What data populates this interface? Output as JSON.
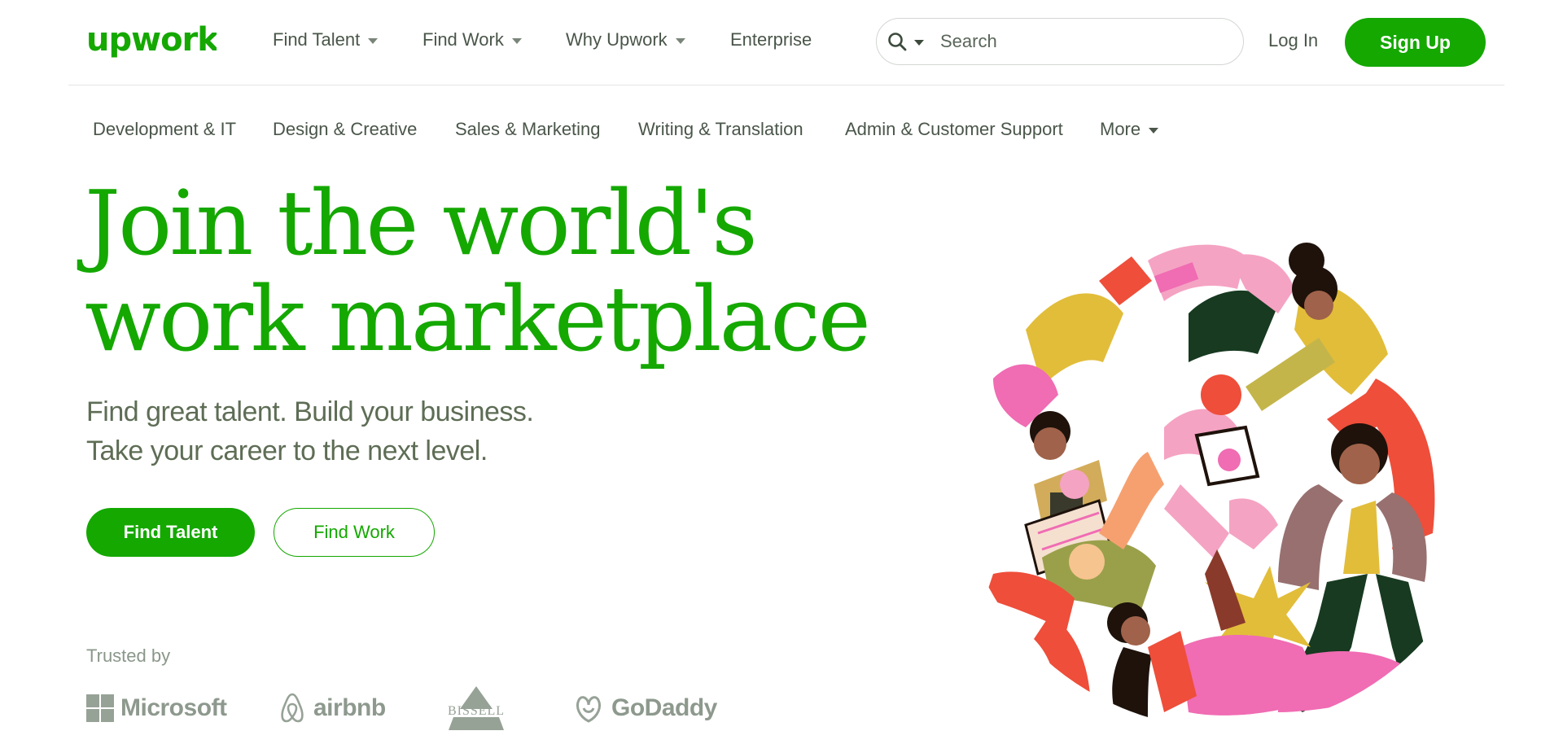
{
  "header": {
    "logo_text": "upwork",
    "nav": [
      {
        "label": "Find Talent",
        "has_menu": true
      },
      {
        "label": "Find Work",
        "has_menu": true
      },
      {
        "label": "Why Upwork",
        "has_menu": true
      },
      {
        "label": "Enterprise",
        "has_menu": false
      }
    ],
    "search": {
      "placeholder": "Search",
      "value": ""
    },
    "login_label": "Log In",
    "signup_label": "Sign Up"
  },
  "categories": [
    "Development & IT",
    "Design & Creative",
    "Sales & Marketing",
    "Writing & Translation",
    "Admin & Customer Support",
    "More"
  ],
  "hero": {
    "headline": [
      "Join the world's",
      "work marketplace"
    ],
    "subline": [
      "Find great talent. Build your business.",
      "Take your career to the next level."
    ],
    "primary_cta": "Find Talent",
    "secondary_cta": "Find Work"
  },
  "trusted": {
    "label": "Trusted by",
    "brands": [
      "Microsoft",
      "airbnb",
      "BISSELL",
      "GoDaddy"
    ]
  },
  "colors": {
    "brand_green": "#14a800",
    "text_dark": "#4a564a",
    "muted_gray": "#8e998e"
  },
  "icons": {
    "search": "search-icon",
    "dropdown": "chevron-down-icon"
  }
}
